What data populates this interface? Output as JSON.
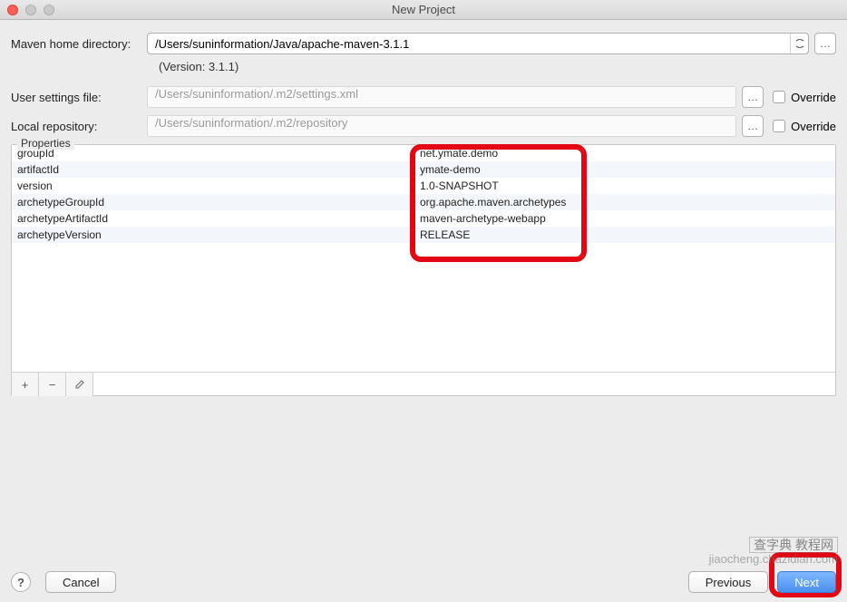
{
  "window": {
    "title": "New Project"
  },
  "fields": {
    "mavenHome": {
      "label": "Maven home directory:",
      "value": "/Users/suninformation/Java/apache-maven-3.1.1"
    },
    "version": "(Version: 3.1.1)",
    "userSettings": {
      "label": "User settings file:",
      "value": "/Users/suninformation/.m2/settings.xml",
      "override": "Override"
    },
    "localRepo": {
      "label": "Local repository:",
      "value": "/Users/suninformation/.m2/repository",
      "override": "Override"
    }
  },
  "propertiesLabel": "Properties",
  "properties": [
    {
      "key": "groupId",
      "value": "net.ymate.demo"
    },
    {
      "key": "artifactId",
      "value": "ymate-demo"
    },
    {
      "key": "version",
      "value": "1.0-SNAPSHOT"
    },
    {
      "key": "archetypeGroupId",
      "value": "org.apache.maven.archetypes"
    },
    {
      "key": "archetypeArtifactId",
      "value": "maven-archetype-webapp"
    },
    {
      "key": "archetypeVersion",
      "value": "RELEASE"
    }
  ],
  "toolbar": {
    "add": "+",
    "remove": "−",
    "edit": "✎"
  },
  "footer": {
    "help": "?",
    "cancel": "Cancel",
    "previous": "Previous",
    "next": "Next"
  },
  "watermark": {
    "line1": "查字典 教程网",
    "line2": "jiaocheng.chazidian.com"
  }
}
